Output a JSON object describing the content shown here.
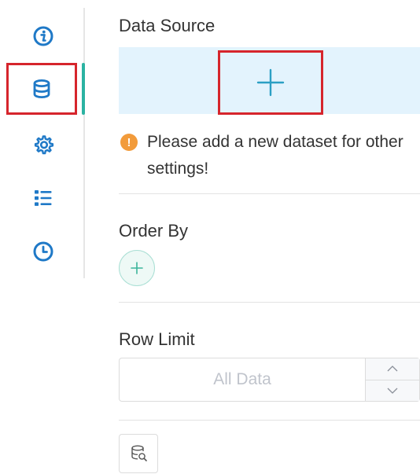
{
  "rail": {
    "items": [
      {
        "name": "info-icon"
      },
      {
        "name": "database-icon",
        "active": true
      },
      {
        "name": "gear-icon"
      },
      {
        "name": "list-icon"
      },
      {
        "name": "clock-icon"
      }
    ],
    "icon_color": "#1f79c7",
    "active_color": "#2bb3a2"
  },
  "data_source": {
    "title": "Data Source",
    "area_color": "#e3f3fd",
    "add_icon": "plus-icon",
    "tip_icon": "info-icon",
    "tip_text": "Please add a new dataset for other settings!"
  },
  "order_by": {
    "title": "Order By",
    "add_icon": "plus-icon"
  },
  "row_limit": {
    "title": "Row Limit",
    "placeholder": "All Data",
    "up_icon": "chevron-up-icon",
    "down_icon": "chevron-down-icon"
  },
  "footer": {
    "icon": "database-search-icon"
  },
  "colors": {
    "highlight": "#d6252c",
    "warning": "#f29b3b"
  }
}
